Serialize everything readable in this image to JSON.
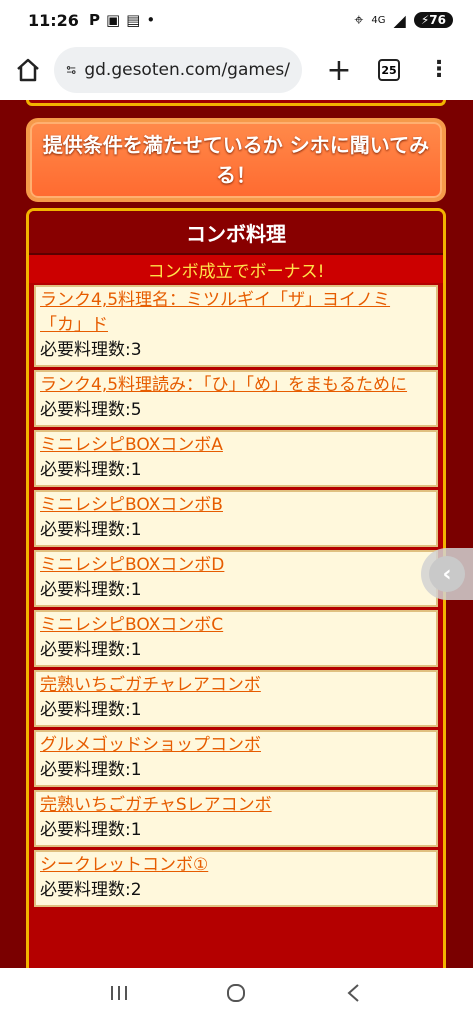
{
  "status_bar": {
    "time": "11:26",
    "notification_icons": [
      "parking-icon",
      "screenshot-icon",
      "clipboard-icon",
      "dot-icon"
    ],
    "network": "4G",
    "battery": "76"
  },
  "browser": {
    "url": "gd.gesoten.com/games/",
    "tab_count": "25"
  },
  "ask_button": {
    "label": "提供条件を満たせているか シホに聞いてみる！"
  },
  "combo_panel": {
    "title": "コンボ料理",
    "subtitle": "コンボ成立でボーナス!",
    "items": [
      {
        "name": "ランク4,5料理名：ミツルギイ「ザ」ヨイノミ「カ」ド",
        "req": "必要料理数:3"
      },
      {
        "name": "ランク4,5料理読み：「ひ」「め」をまもるために",
        "req": "必要料理数:5"
      },
      {
        "name": "ミニレシピBOXコンボA",
        "req": "必要料理数:1"
      },
      {
        "name": "ミニレシピBOXコンボB",
        "req": "必要料理数:1"
      },
      {
        "name": "ミニレシピBOXコンボD",
        "req": "必要料理数:1"
      },
      {
        "name": "ミニレシピBOXコンボC",
        "req": "必要料理数:1"
      },
      {
        "name": "完熟いちごガチャレアコンボ",
        "req": "必要料理数:1"
      },
      {
        "name": "グルメゴッドショップコンボ",
        "req": "必要料理数:1"
      },
      {
        "name": "完熟いちごガチャSレアコンボ",
        "req": "必要料理数:1"
      },
      {
        "name": "シークレットコンボ①",
        "req": "必要料理数:2"
      }
    ]
  },
  "colors": {
    "page_background": "#7a0000",
    "panel_border": "#f2b400",
    "link_orange": "#e65c00",
    "subtitle_yellow": "#ffe14a",
    "button_orange": "#ff6a30"
  }
}
